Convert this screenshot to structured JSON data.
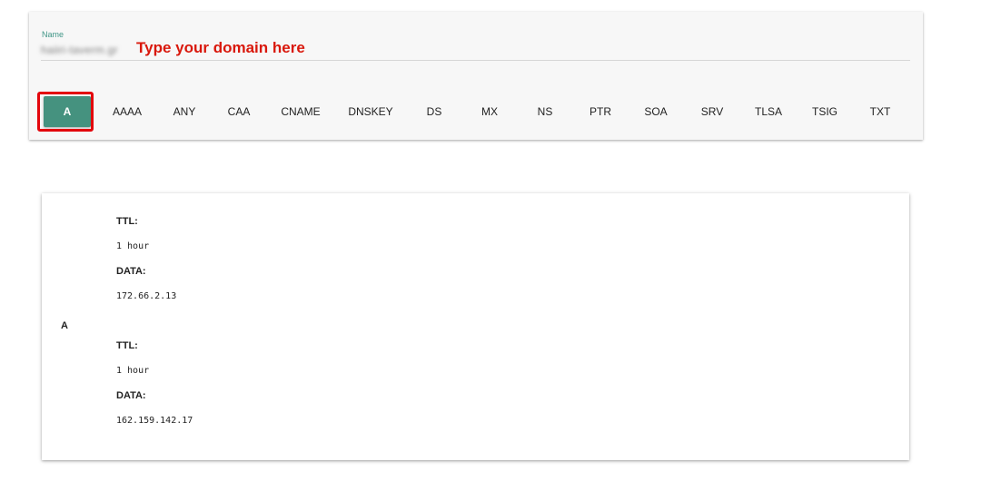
{
  "query": {
    "label": "Name",
    "value": "haiiri-taverm.gr",
    "hint": "Type your domain here"
  },
  "record_types": [
    "A",
    "AAAA",
    "ANY",
    "CAA",
    "CNAME",
    "DNSKEY",
    "DS",
    "MX",
    "NS",
    "PTR",
    "SOA",
    "SRV",
    "TLSA",
    "TSIG",
    "TXT"
  ],
  "active_type": "A",
  "result": {
    "type": "A",
    "records": [
      {
        "ttl_label": "TTL:",
        "ttl": "1 hour",
        "data_label": "DATA:",
        "data": "172.66.2.13"
      },
      {
        "ttl_label": "TTL:",
        "ttl": "1 hour",
        "data_label": "DATA:",
        "data": "162.159.142.17"
      }
    ]
  },
  "colors": {
    "accent": "#45927f",
    "highlight": "#e3060c",
    "hint": "#d9180c"
  }
}
